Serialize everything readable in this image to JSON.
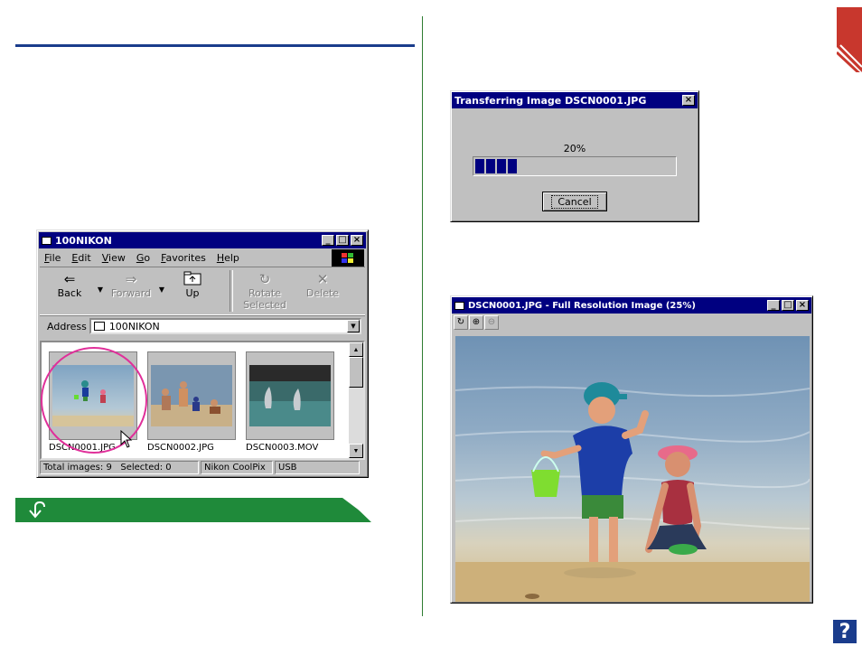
{
  "explorer": {
    "title": "100NIKON",
    "menu": [
      "File",
      "Edit",
      "View",
      "Go",
      "Favorites",
      "Help"
    ],
    "toolbar": {
      "back": "Back",
      "forward": "Forward",
      "up": "Up",
      "rotate_line1": "Rotate",
      "rotate_line2": "Selected",
      "delete": "Delete"
    },
    "address_label": "Address",
    "address_value": "100NIKON",
    "files": [
      "DSCN0001.JPG",
      "DSCN0002.JPG",
      "DSCN0003.MOV"
    ],
    "status": {
      "total": "Total images:  9",
      "selected": "Selected:  0",
      "device": "Nikon CoolPix",
      "port": "USB"
    }
  },
  "transfer": {
    "title": "Transferring Image DSCN0001.JPG",
    "percent_label": "20%",
    "progress": 0.2,
    "cancel": "Cancel"
  },
  "viewer": {
    "title": "DSCN0001.JPG - Full Resolution Image (25%)"
  },
  "help": "?",
  "colors": {
    "accent_blue": "#1a3c8c",
    "divider_green": "#2e7d32",
    "tip_green": "#1f8a3a",
    "corner_red": "#c8372d",
    "highlight_magenta": "#e0309a"
  }
}
